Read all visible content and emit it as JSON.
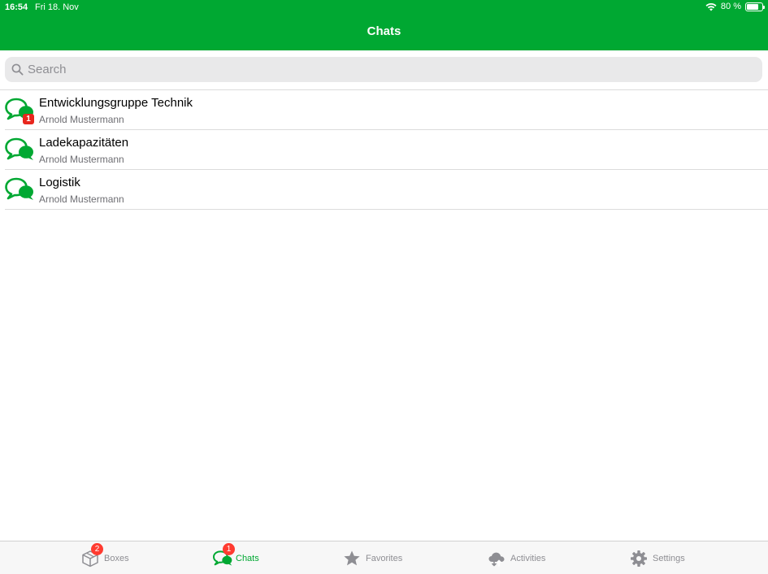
{
  "status_bar": {
    "time": "16:54",
    "date": "Fri 18. Nov",
    "battery": "80 %",
    "battery_level": 0.8
  },
  "nav": {
    "title": "Chats"
  },
  "search": {
    "placeholder": "Search",
    "value": ""
  },
  "chats": [
    {
      "title": "Entwicklungsgruppe Technik",
      "subtitle": "Arnold Mustermann",
      "badge": "1"
    },
    {
      "title": "Ladekapazitäten",
      "subtitle": "Arnold Mustermann",
      "badge": ""
    },
    {
      "title": "Logistik",
      "subtitle": "Arnold Mustermann",
      "badge": ""
    }
  ],
  "tabs": [
    {
      "label": "Boxes",
      "icon": "box-icon",
      "badge": "2",
      "active": false
    },
    {
      "label": "Chats",
      "icon": "chat-bubbles-icon",
      "badge": "1",
      "active": true
    },
    {
      "label": "Favorites",
      "icon": "star-icon",
      "badge": "",
      "active": false
    },
    {
      "label": "Activities",
      "icon": "cloud-sync-icon",
      "badge": "",
      "active": false
    },
    {
      "label": "Settings",
      "icon": "gear-icon",
      "badge": "",
      "active": false
    }
  ],
  "colors": {
    "brand": "#00a832",
    "badge": "#e8261d",
    "tab_badge": "#ff3b30",
    "inactive": "#8e8e93"
  }
}
